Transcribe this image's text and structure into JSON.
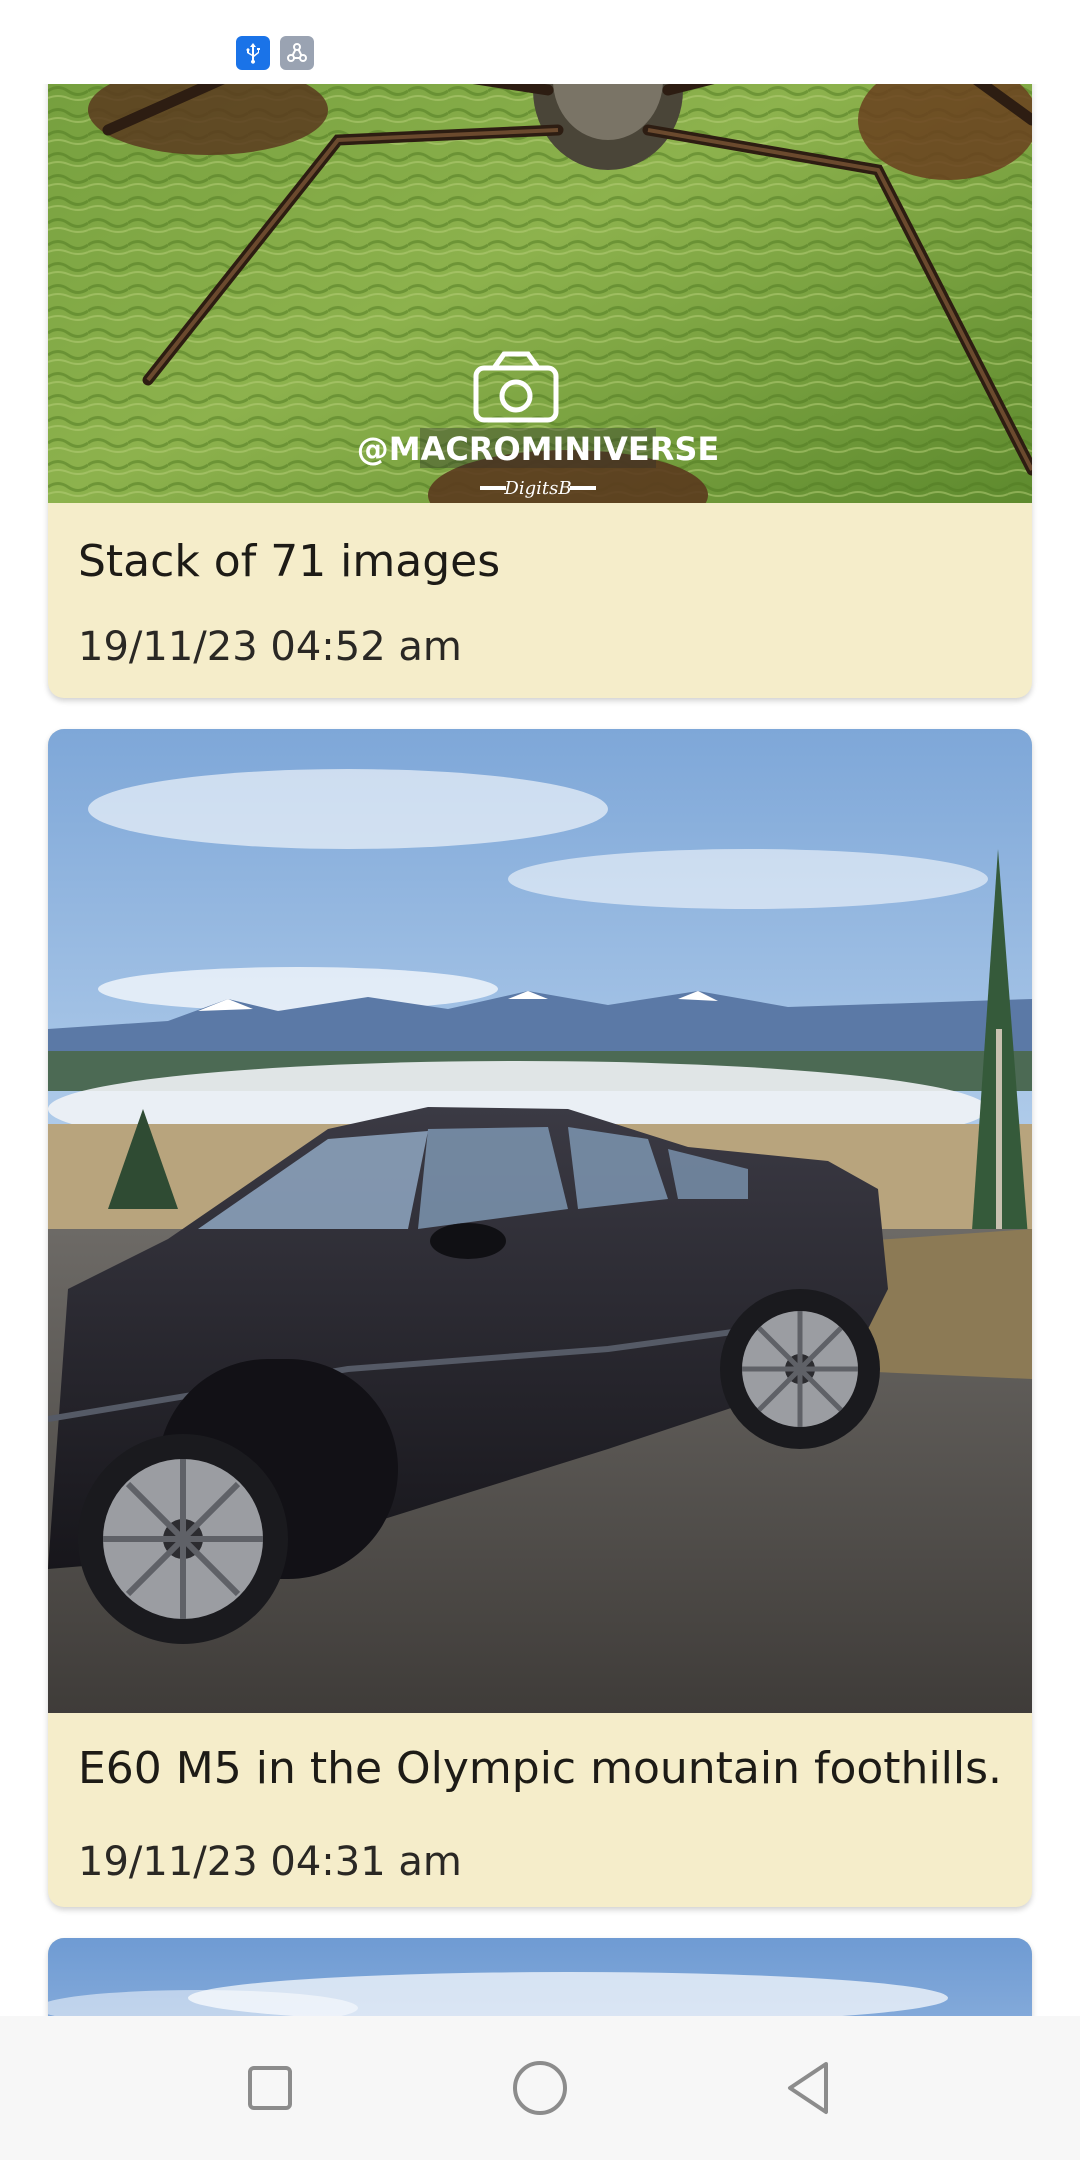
{
  "status_bar": {
    "icons": [
      "usb-icon",
      "tethering-icon"
    ]
  },
  "posts": [
    {
      "title": "Stack of 71 images",
      "date": "19/11/23 04:52 am",
      "photo_icon": "spider-macro-photo",
      "watermark": "@MACROMINIVERSE",
      "watermark_signature": "DigitsB"
    },
    {
      "title": "E60 M5 in the Olympic mountain foothills.",
      "date": "19/11/23 04:31 am",
      "photo_icon": "car-mountains-photo"
    },
    {
      "photo_icon": "sky-photo"
    }
  ],
  "nav_bar": {
    "buttons": [
      "recent-apps-icon",
      "home-icon",
      "back-icon"
    ]
  },
  "colors": {
    "card_background": "#f5edca",
    "usb_icon_bg": "#1a73e8",
    "tether_icon_bg": "#9aa3b2"
  }
}
